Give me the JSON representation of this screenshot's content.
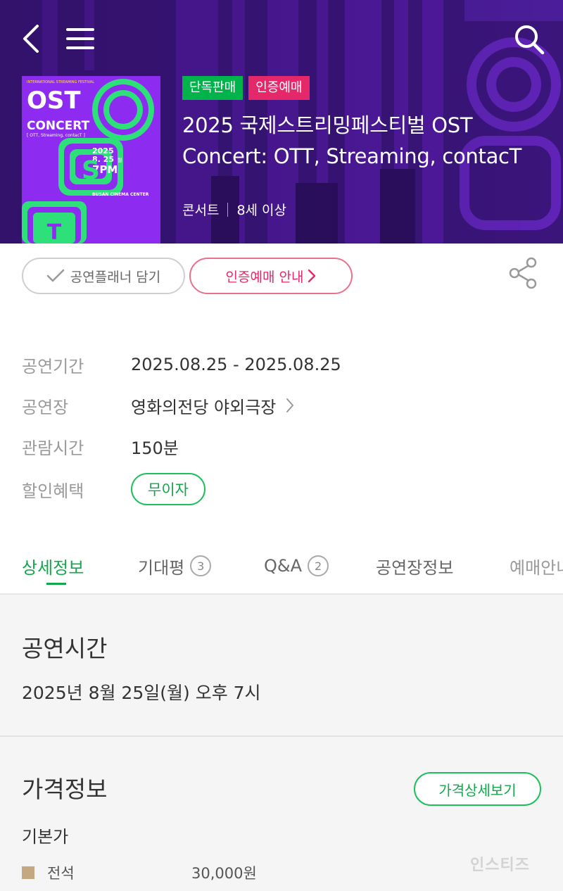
{
  "header": {
    "back_icon": "chevron-left-icon",
    "menu_icon": "hamburger-menu-icon",
    "search_icon": "search-icon"
  },
  "poster": {
    "top_text": "INTERNATIONAL STREAMING FESTIVAL",
    "line1": "OST",
    "line2": "CONCERT",
    "subtitle": "[ OTT, Streaming, contacT ]",
    "year": "2025",
    "date": "8. 25",
    "day": "월",
    "time": "7PM",
    "venue": "BUSAN CINEMA CENTER",
    "letters": [
      "O",
      "S",
      "T"
    ]
  },
  "badges": [
    "단독판매",
    "인증예매"
  ],
  "title_lines": [
    "2025 국제스트리밍페스티벌 OST",
    "Concert: OTT, Streaming, contacT"
  ],
  "meta": {
    "genre": "콘서트",
    "age": "8세 이상"
  },
  "actions": {
    "planner_label": "공연플래너 담기",
    "auth_label": "인증예매 안내",
    "share_icon": "share-icon"
  },
  "info": {
    "period_label": "공연기간",
    "period_value": "2025.08.25 - 2025.08.25",
    "venue_label": "공연장",
    "venue_value": "영화의전당 야외극장",
    "duration_label": "관람시간",
    "duration_value": "150분",
    "benefit_label": "할인혜택",
    "benefit_value": "무이자"
  },
  "tabs": [
    {
      "label": "상세정보"
    },
    {
      "label": "기대평",
      "count": "3"
    },
    {
      "label": "Q&A",
      "count": "2"
    },
    {
      "label": "공연장정보"
    },
    {
      "label": "예매안내"
    }
  ],
  "showtime": {
    "title": "공연시간",
    "text": "2025년 8월 25일(월) 오후 7시"
  },
  "price": {
    "title": "가격정보",
    "detail_button": "가격상세보기",
    "base_label": "기본가",
    "rows": [
      {
        "name": "전석",
        "amount": "30,000원",
        "color": "#c4a882"
      }
    ]
  },
  "watermark": "인스티즈",
  "colors": {
    "hero_bg": "#3b1a7a",
    "accent_green": "#11a84c",
    "accent_pink": "#e5286a",
    "poster_purple": "#8d2cf0",
    "poster_green": "#2ee07a"
  }
}
